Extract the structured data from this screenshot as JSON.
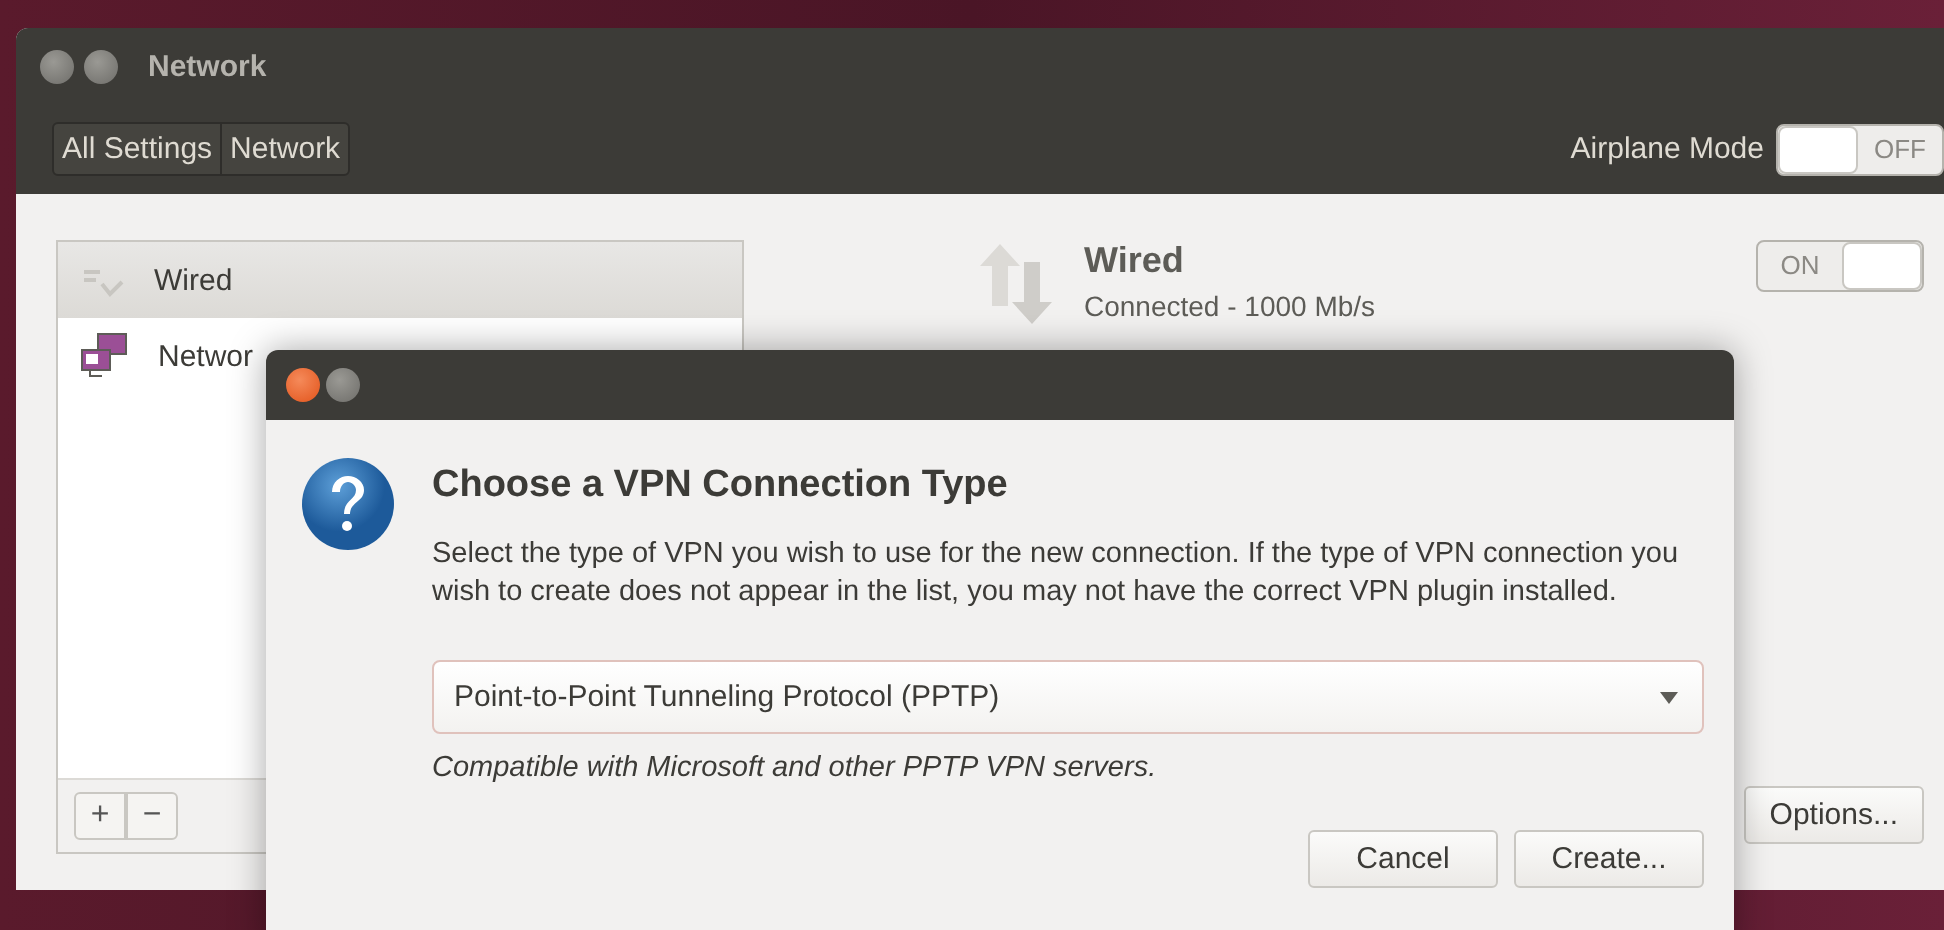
{
  "window": {
    "title": "Network",
    "breadcrumbs": [
      "All Settings",
      "Network"
    ],
    "airplane_mode": {
      "label": "Airplane Mode",
      "on": false,
      "state_text": "OFF"
    }
  },
  "devices": [
    {
      "kind": "wired",
      "label": "Wired",
      "selected": true
    },
    {
      "kind": "network",
      "label": "Networ",
      "selected": false
    }
  ],
  "list_buttons": [
    "+",
    "−"
  ],
  "detail": {
    "title": "Wired",
    "status": "Connected - 1000 Mb/s",
    "switch": {
      "on": true,
      "state_text": "ON"
    },
    "options_button": "Options..."
  },
  "dialog": {
    "title": "Choose a VPN Connection Type",
    "description": "Select the type of VPN you wish to use for the new connection.  If the type of VPN connection you wish to create does not appear in the list, you may not have the correct VPN plugin installed.",
    "select": {
      "value": "Point-to-Point Tunneling Protocol (PPTP)"
    },
    "hint": "Compatible with Microsoft and other PPTP VPN servers.",
    "buttons": [
      "Cancel",
      "Create..."
    ]
  }
}
